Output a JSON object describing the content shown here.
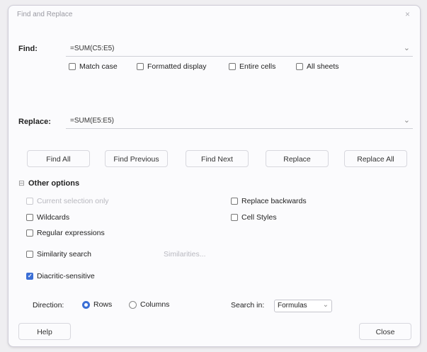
{
  "window": {
    "title": "Find and Replace",
    "close": "×"
  },
  "find": {
    "label": "Find:",
    "value": "=SUM(C5:E5)"
  },
  "find_options": [
    {
      "label": "Match case",
      "checked": false
    },
    {
      "label": "Formatted display",
      "checked": false
    },
    {
      "label": "Entire cells",
      "checked": false
    },
    {
      "label": "All sheets",
      "checked": false
    }
  ],
  "replace": {
    "label": "Replace:",
    "value": "=SUM(E5:E5)"
  },
  "buttons": {
    "find_all": "Find All",
    "find_previous": "Find Previous",
    "find_next": "Find Next",
    "replace": "Replace",
    "replace_all": "Replace All"
  },
  "other_options": {
    "heading": "Other options",
    "expander": "⊟",
    "left": [
      {
        "label": "Current selection only",
        "checked": false,
        "disabled": true
      },
      {
        "label": "Wildcards",
        "checked": false,
        "disabled": false
      },
      {
        "label": "Regular expressions",
        "checked": false,
        "disabled": false
      },
      {
        "label": "Similarity search",
        "checked": false,
        "disabled": false
      },
      {
        "label": "Diacritic-sensitive",
        "checked": true,
        "disabled": false
      }
    ],
    "right": [
      {
        "label": "Replace backwards",
        "checked": false
      },
      {
        "label": "Cell Styles",
        "checked": false
      }
    ],
    "similarities_button": "Similarities..."
  },
  "direction": {
    "label": "Direction:",
    "options": [
      {
        "label": "Rows",
        "selected": true
      },
      {
        "label": "Columns",
        "selected": false
      }
    ]
  },
  "search_in": {
    "label": "Search in:",
    "value": "Formulas"
  },
  "footer": {
    "help": "Help",
    "close": "Close"
  },
  "colors": {
    "accent": "#3b6fd6",
    "border": "#cfcdd8",
    "disabled_text": "#b8b8bf"
  }
}
